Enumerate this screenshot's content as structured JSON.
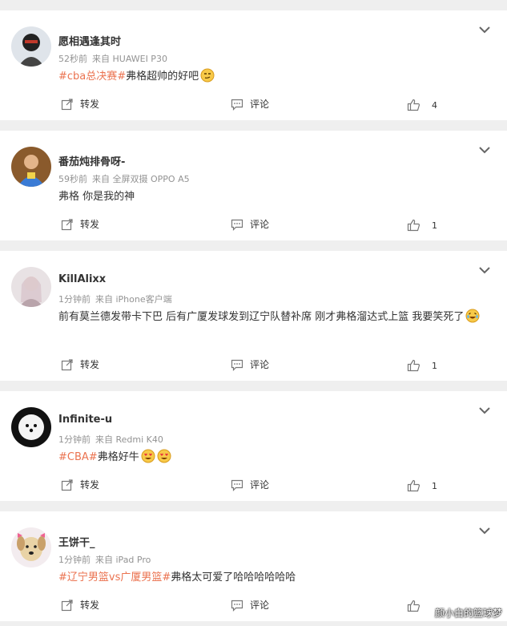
{
  "comments": [
    {
      "username": "愿相遇逢其时",
      "time": "52秒前",
      "source": "来自 HUAWEI P30",
      "text_parts": [
        {
          "text": "#cba总决赛#",
          "type": "tag"
        },
        {
          "text": "弗格超帅的好吧",
          "type": "text"
        }
      ],
      "emojis": [
        "smug-face-emoji"
      ],
      "actions": {
        "repost": "转发",
        "comment": "评论",
        "like_count": "4"
      }
    },
    {
      "username": "番茄炖排骨呀-",
      "time": "59秒前",
      "source": "来自 全屏双摄 OPPO A5",
      "text_parts": [
        {
          "text": "弗格 你是我的神",
          "type": "text"
        }
      ],
      "emojis": [],
      "actions": {
        "repost": "转发",
        "comment": "评论",
        "like_count": "1"
      }
    },
    {
      "username": "KillAlixx",
      "time": "1分钟前",
      "source": "来自 iPhone客户端",
      "text_parts": [
        {
          "text": "前有莫兰德发带卡下巴 后有广厦发球发到辽宁队替补席 刚才弗格溜达式上篮 我要笑死了",
          "type": "text"
        }
      ],
      "emojis": [
        "laughing-tears-emoji"
      ],
      "actions": {
        "repost": "转发",
        "comment": "评论",
        "like_count": "1"
      }
    },
    {
      "username": "Infinite-u",
      "time": "1分钟前",
      "source": "来自 Redmi K40",
      "text_parts": [
        {
          "text": "#CBA#",
          "type": "tag"
        },
        {
          "text": "弗格好牛",
          "type": "text"
        }
      ],
      "emojis": [
        "heart-eyes-emoji",
        "heart-eyes-emoji"
      ],
      "actions": {
        "repost": "转发",
        "comment": "评论",
        "like_count": "1"
      }
    },
    {
      "username": "王饼干_",
      "time": "1分钟前",
      "source": "来自 iPad Pro",
      "text_parts": [
        {
          "text": "#辽宁男篮vs广厦男篮#",
          "type": "tag"
        },
        {
          "text": "弗格太可爱了哈哈哈哈哈哈",
          "type": "text"
        }
      ],
      "emojis": [],
      "actions": {
        "repost": "转发",
        "comment": "评论",
        "like_count": ""
      }
    }
  ],
  "watermark": "颜小白的篮球梦",
  "colors": {
    "tag": "#eb7350",
    "meta": "#939393",
    "background": "#efefef"
  }
}
